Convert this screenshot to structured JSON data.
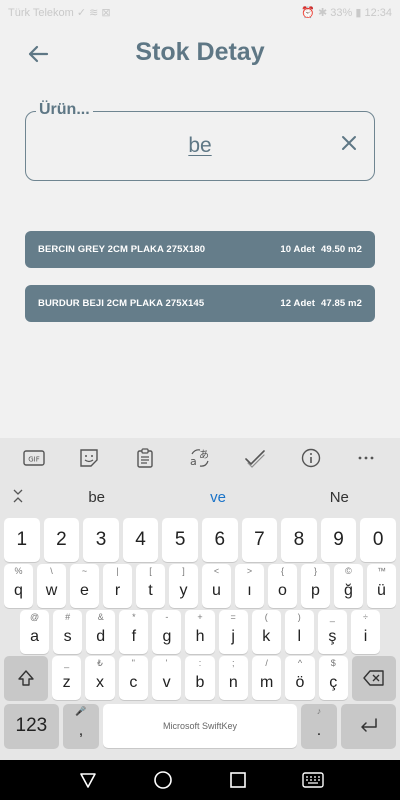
{
  "status_bar": {
    "left": "Türk Telekom  ✓  ≋  ⊠",
    "right": "⏰  ✱  33%  ▮  12:34"
  },
  "header": {
    "title": "Stok Detay"
  },
  "search": {
    "label": "Ürün...",
    "value": "be"
  },
  "results": [
    {
      "name": "BERCIN GREY 2CM PLAKA 275X180",
      "qty": "10 Adet",
      "area": "49.50 m2"
    },
    {
      "name": "BURDUR BEJI 2CM PLAKA 275X145",
      "qty": "12 Adet",
      "area": "47.85 m2"
    }
  ],
  "keyboard": {
    "suggestions": [
      "be",
      "ve",
      "Ne"
    ],
    "numbers": [
      "1",
      "2",
      "3",
      "4",
      "5",
      "6",
      "7",
      "8",
      "9",
      "0"
    ],
    "row1": [
      {
        "k": "q",
        "a": "%"
      },
      {
        "k": "w",
        "a": "\\"
      },
      {
        "k": "e",
        "a": "~"
      },
      {
        "k": "r",
        "a": "|"
      },
      {
        "k": "t",
        "a": "["
      },
      {
        "k": "y",
        "a": "]"
      },
      {
        "k": "u",
        "a": "<"
      },
      {
        "k": "ı",
        "a": ">"
      },
      {
        "k": "o",
        "a": "{"
      },
      {
        "k": "p",
        "a": "}"
      },
      {
        "k": "ğ",
        "a": "©"
      },
      {
        "k": "ü",
        "a": "™"
      }
    ],
    "row2": [
      {
        "k": "a",
        "a": "@"
      },
      {
        "k": "s",
        "a": "#"
      },
      {
        "k": "d",
        "a": "&"
      },
      {
        "k": "f",
        "a": "*"
      },
      {
        "k": "g",
        "a": "-"
      },
      {
        "k": "h",
        "a": "+"
      },
      {
        "k": "j",
        "a": "="
      },
      {
        "k": "k",
        "a": "("
      },
      {
        "k": "l",
        "a": ")"
      },
      {
        "k": "ş",
        "a": "_"
      },
      {
        "k": "i",
        "a": "÷"
      }
    ],
    "row3": [
      {
        "k": "z",
        "a": "_"
      },
      {
        "k": "x",
        "a": "₺"
      },
      {
        "k": "c",
        "a": "\""
      },
      {
        "k": "v",
        "a": "'"
      },
      {
        "k": "b",
        "a": ":"
      },
      {
        "k": "n",
        "a": ";"
      },
      {
        "k": "m",
        "a": "/"
      },
      {
        "k": "ö",
        "a": "^"
      },
      {
        "k": "ç",
        "a": "$"
      }
    ],
    "bottom": {
      "numkey": "123",
      "comma_alt": "🎤",
      "comma": ",",
      "space": "Microsoft SwiftKey",
      "period_alt": "♪",
      "period": "."
    }
  }
}
